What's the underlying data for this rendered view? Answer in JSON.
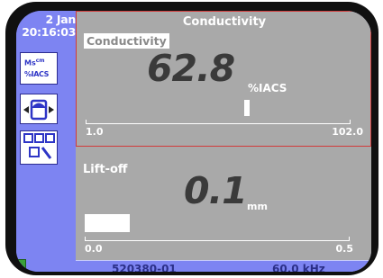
{
  "sidebar": {
    "date": "2 Jan",
    "time": "20:16:03",
    "units_button": {
      "line1": "Ms",
      "line1_sup": "cm",
      "line2": "%IACS"
    },
    "probe_icon": "probe-balance-icon",
    "layout_icon": "display-layout-icon",
    "battery_icon": "battery-icon"
  },
  "conductivity_panel": {
    "header": "Conductivity",
    "label": "Conductivity",
    "value": "62.8",
    "unit": "%IACS",
    "scale_min": "1.0",
    "scale_max": "102.0",
    "reading_level": 0.61
  },
  "liftoff_panel": {
    "label": "Lift-off",
    "value": "0.1",
    "unit": "mm",
    "scale_min": "0.0",
    "scale_max": "0.5",
    "reading_level": 0.2
  },
  "status_bar": {
    "probe_id": "520380-01",
    "frequency": "60.0 kHz"
  },
  "colors": {
    "screen_blue": "#7d84f2",
    "panel_gray": "#a9a9a9",
    "active_border": "#d13b3b"
  }
}
